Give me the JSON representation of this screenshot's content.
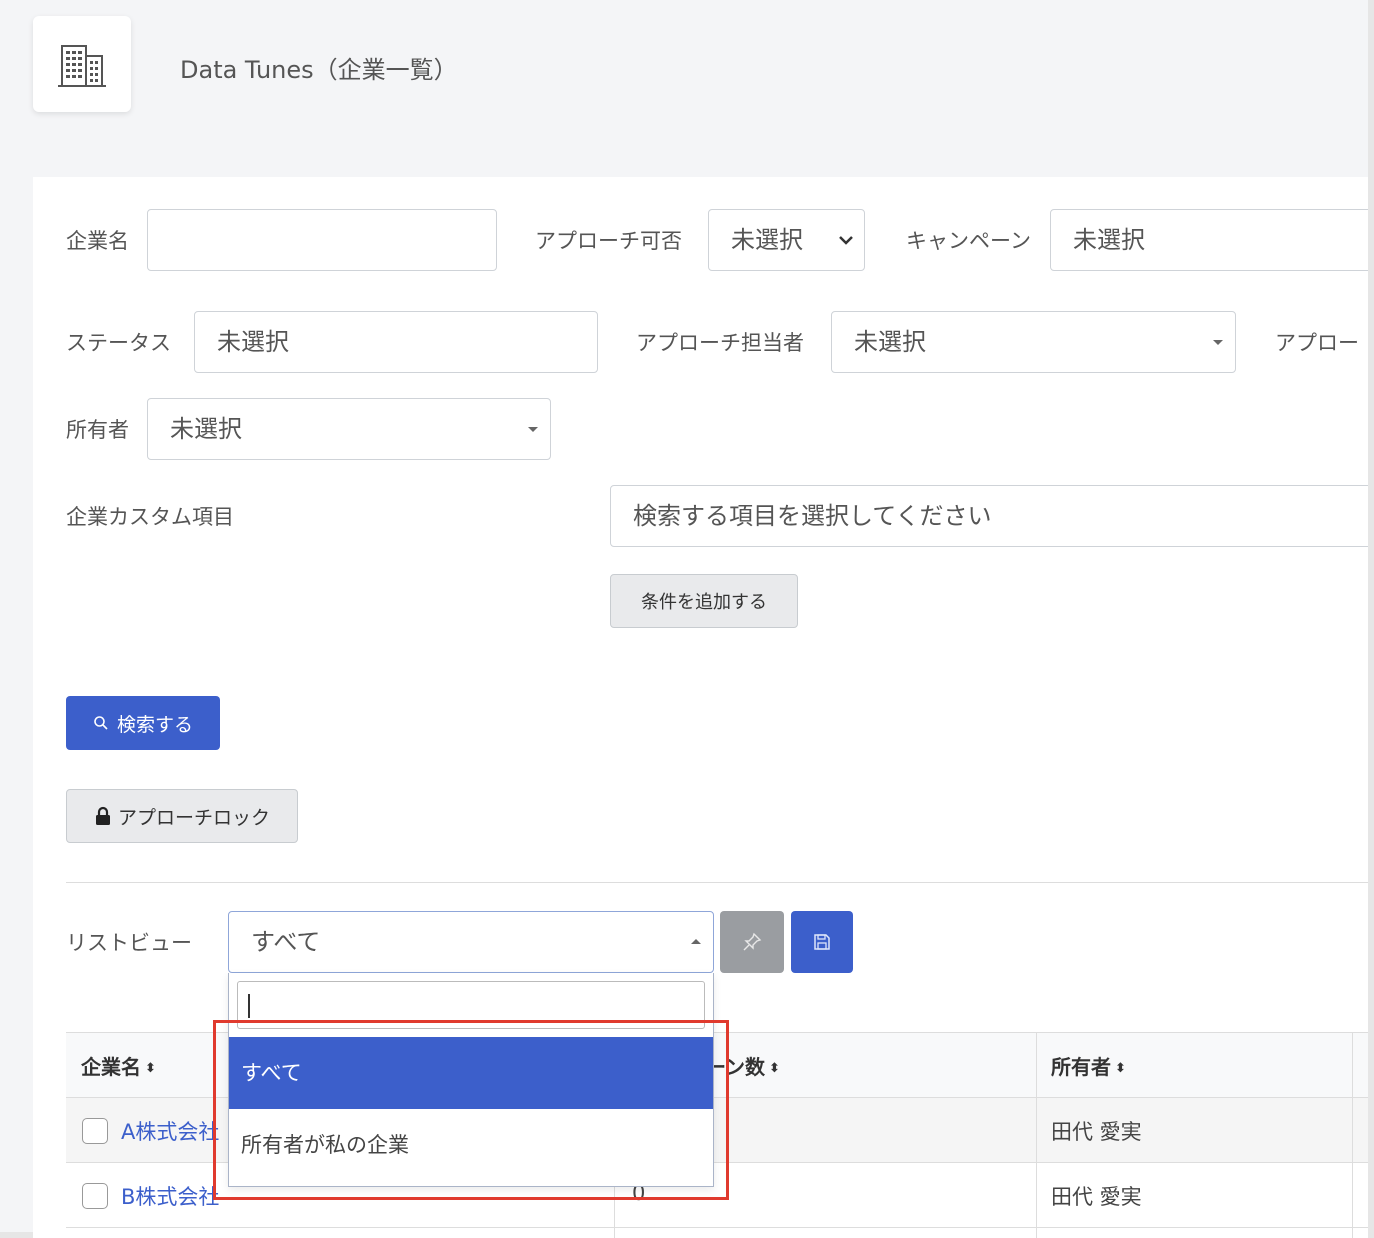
{
  "header": {
    "title": "Data Tunes（企業一覧）",
    "logo_icon": "building-icon"
  },
  "filters": {
    "company_name": {
      "label": "企業名",
      "value": ""
    },
    "approach_ok": {
      "label": "アプローチ可否",
      "value": "未選択"
    },
    "campaign": {
      "label": "キャンペーン",
      "value": "未選択"
    },
    "status": {
      "label": "ステータス",
      "value": "未選択"
    },
    "approach_owner": {
      "label": "アプローチ担当者",
      "value": "未選択"
    },
    "approach_cut_label": "アプロー",
    "owner": {
      "label": "所有者",
      "value": "未選択"
    },
    "custom_fields": {
      "label": "企業カスタム項目",
      "placeholder": "検索する項目を選択してください"
    },
    "add_condition_label": "条件を追加する"
  },
  "buttons": {
    "search_label": "検索する",
    "approach_lock_label": "アプローチロック"
  },
  "list_view": {
    "label": "リストビュー",
    "value": "すべて",
    "options": [
      "すべて",
      "所有者が私の企業"
    ]
  },
  "table": {
    "columns": [
      "企業名",
      "ーン数",
      "所有者"
    ],
    "rows": [
      {
        "name": "A株式会社",
        "count": "",
        "owner": "田代 愛実"
      },
      {
        "name": "B株式会社",
        "count": "0",
        "owner": "田代 愛実"
      }
    ]
  },
  "colors": {
    "accent": "#3c5fcb",
    "highlight": "#e03a2e"
  }
}
